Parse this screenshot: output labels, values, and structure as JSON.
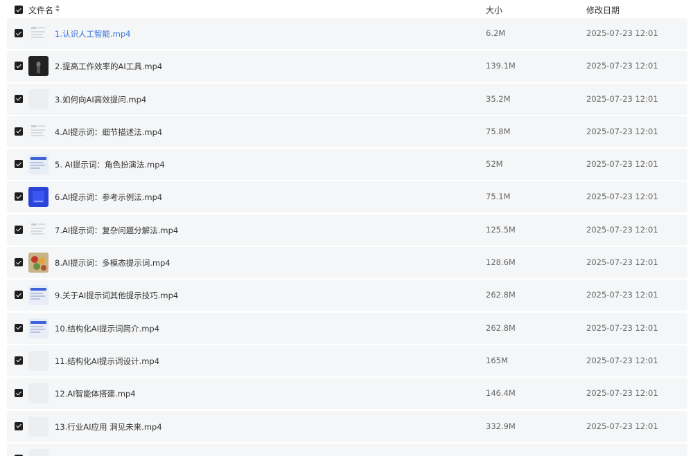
{
  "header": {
    "name_label": "文件名",
    "size_label": "大小",
    "date_label": "修改日期"
  },
  "files": [
    {
      "name": "1.认识人工智能.mp4",
      "size": "6.2M",
      "date": "2025-07-23 12:01",
      "thumb": "doc",
      "active": true
    },
    {
      "name": "2.提高工作效率的AI工具.mp4",
      "size": "139.1M",
      "date": "2025-07-23 12:01",
      "thumb": "dark"
    },
    {
      "name": "3.如何向AI高效提问.mp4",
      "size": "35.2M",
      "date": "2025-07-23 12:01",
      "thumb": "blank"
    },
    {
      "name": "4.AI提示词：细节描述法.mp4",
      "size": "75.8M",
      "date": "2025-07-23 12:01",
      "thumb": "doc"
    },
    {
      "name": "5. AI提示词：角色扮演法.mp4",
      "size": "52M",
      "date": "2025-07-23 12:01",
      "thumb": "blue"
    },
    {
      "name": "6.AI提示词：参考示例法.mp4",
      "size": "75.1M",
      "date": "2025-07-23 12:01",
      "thumb": "blue2"
    },
    {
      "name": "7.AI提示词：复杂问题分解法.mp4",
      "size": "125.5M",
      "date": "2025-07-23 12:01",
      "thumb": "doc"
    },
    {
      "name": "8.AI提示词：多模态提示词.mp4",
      "size": "128.6M",
      "date": "2025-07-23 12:01",
      "thumb": "food"
    },
    {
      "name": "9.关于AI提示词其他提示技巧.mp4",
      "size": "262.8M",
      "date": "2025-07-23 12:01",
      "thumb": "blue"
    },
    {
      "name": "10.结构化AI提示词简介.mp4",
      "size": "262.8M",
      "date": "2025-07-23 12:01",
      "thumb": "blue"
    },
    {
      "name": "11.结构化AI提示词设计.mp4",
      "size": "165M",
      "date": "2025-07-23 12:01",
      "thumb": "blank"
    },
    {
      "name": "12.AI智能体搭建.mp4",
      "size": "146.4M",
      "date": "2025-07-23 12:01",
      "thumb": "blank"
    },
    {
      "name": "13.行业AI应用 洞见未来.mp4",
      "size": "332.9M",
      "date": "2025-07-23 12:01",
      "thumb": "blank"
    }
  ]
}
